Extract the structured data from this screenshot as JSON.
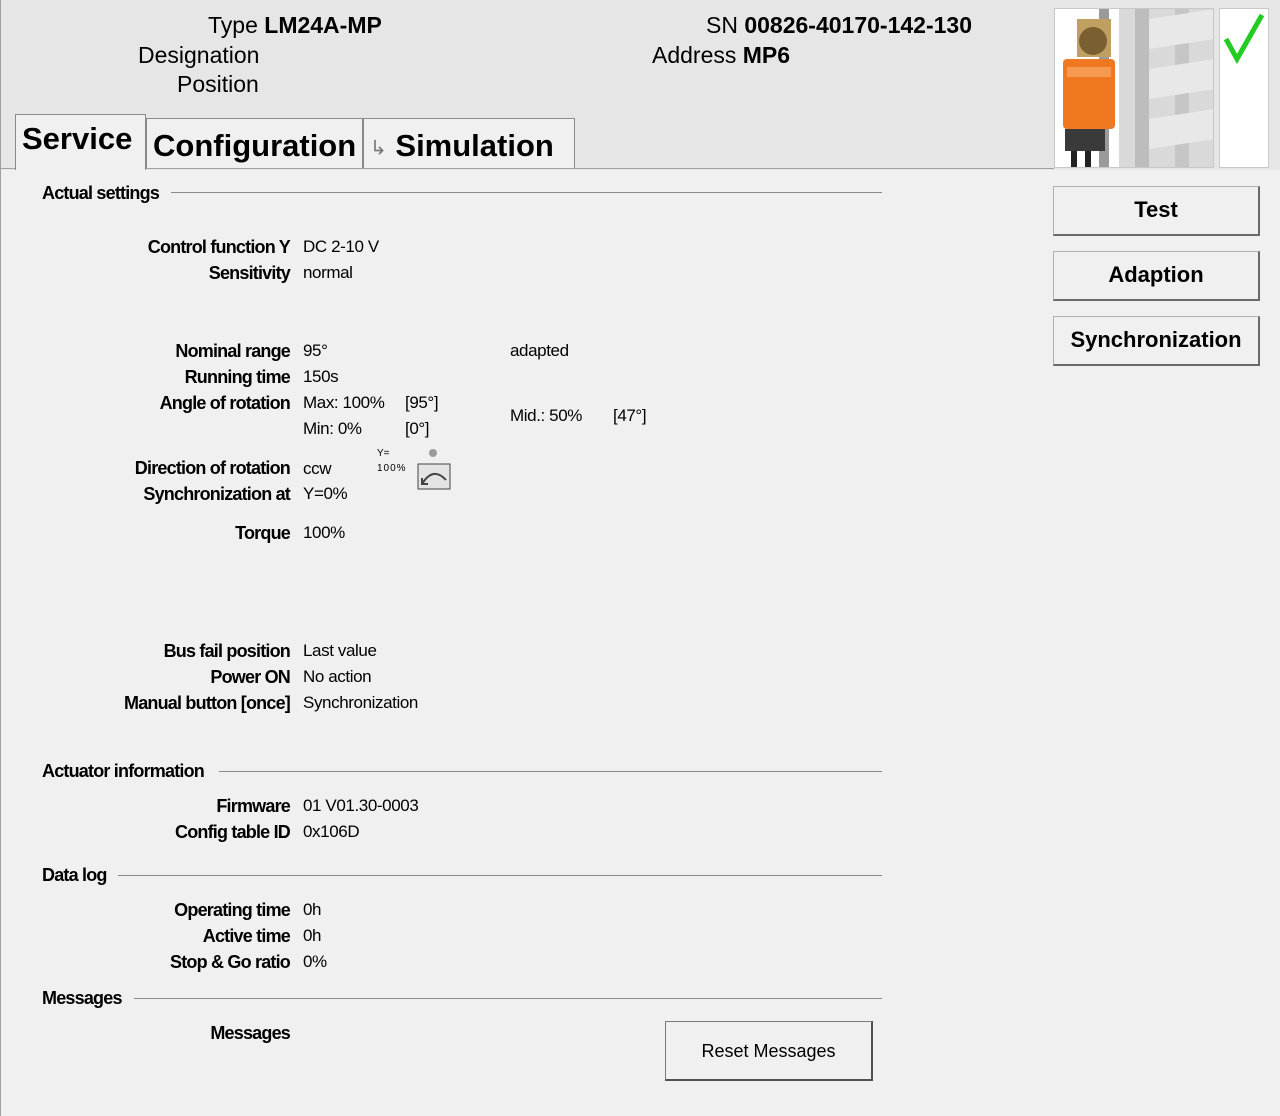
{
  "header": {
    "type_label": "Type",
    "type_value": "LM24A-MP",
    "designation_label": "Designation",
    "position_label": "Position",
    "sn_label": "SN",
    "sn_value": "00826-40170-142-130",
    "address_label": "Address",
    "address_value": "MP6",
    "status_icon": "green-checkmark-icon",
    "status_color": "#22cc22"
  },
  "tabs": [
    {
      "label": "Service",
      "active": true
    },
    {
      "label": "Configuration",
      "active": false
    },
    {
      "label": "Simulation",
      "active": false,
      "icon": "simulation-arrow-icon"
    }
  ],
  "sections": {
    "actual_settings": "Actual settings",
    "actuator_information": "Actuator information",
    "data_log": "Data log",
    "messages": "Messages"
  },
  "actual_settings": {
    "control_function_label": "Control function Y",
    "control_function_value": "DC 2-10 V",
    "sensitivity_label": "Sensitivity",
    "sensitivity_value": "normal",
    "nominal_range_label": "Nominal range",
    "nominal_range_value": "95°",
    "nominal_range_status": "adapted",
    "running_time_label": "Running time",
    "running_time_value": "150s",
    "angle_label": "Angle of rotation",
    "angle_max": "Max: 100%",
    "angle_max_deg": "[95°]",
    "angle_min": "Min: 0%",
    "angle_min_deg": "[0°]",
    "angle_mid": "Mid.: 50%",
    "angle_mid_deg": "[47°]",
    "direction_label": "Direction of rotation",
    "direction_value": "ccw",
    "direction_icon_y": "Y=",
    "direction_icon_pct": "100%",
    "sync_label": "Synchronization at",
    "sync_value": "Y=0%",
    "torque_label": "Torque",
    "torque_value": "100%",
    "bus_fail_label": "Bus fail position",
    "bus_fail_value": "Last value",
    "power_on_label": "Power ON",
    "power_on_value": "No action",
    "manual_button_label": "Manual button [once]",
    "manual_button_value": "Synchronization"
  },
  "actuator_information": {
    "firmware_label": "Firmware",
    "firmware_value": "01 V01.30-0003",
    "config_table_label": "Config table ID",
    "config_table_value": "0x106D"
  },
  "data_log": {
    "operating_time_label": "Operating time",
    "operating_time_value": "0h",
    "active_time_label": "Active time",
    "active_time_value": "0h",
    "stop_go_label": "Stop & Go ratio",
    "stop_go_value": "0%"
  },
  "messages": {
    "messages_label": "Messages",
    "reset_button": "Reset Messages"
  },
  "side_buttons": {
    "test": "Test",
    "adaption": "Adaption",
    "synchronization": "Synchronization"
  }
}
